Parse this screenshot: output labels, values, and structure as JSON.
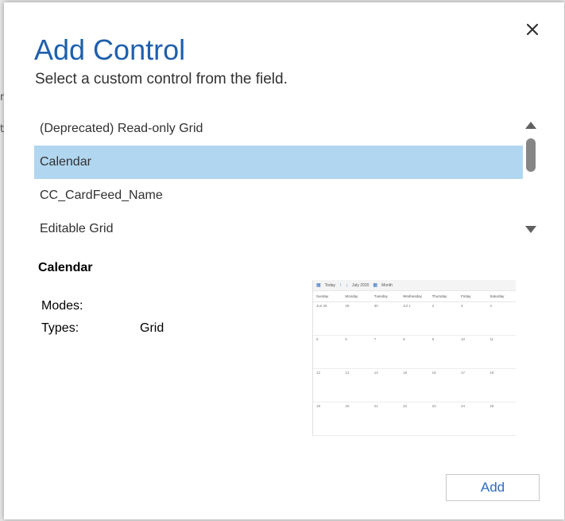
{
  "dialog": {
    "title": "Add Control",
    "subtitle": "Select a custom control from the field.",
    "close_icon": "close-icon"
  },
  "control_list": {
    "items": [
      {
        "label": "(Deprecated) Read-only Grid",
        "selected": false
      },
      {
        "label": "Calendar",
        "selected": true
      },
      {
        "label": "CC_CardFeed_Name",
        "selected": false
      },
      {
        "label": "Editable Grid",
        "selected": false
      }
    ],
    "selected_color": "#b1d6f0"
  },
  "details": {
    "title": "Calendar",
    "modes_label": "Modes:",
    "modes_value": "",
    "types_label": "Types:",
    "types_value": "Grid"
  },
  "preview": {
    "toolbar": {
      "today": "Today",
      "up": "↑",
      "down": "↓",
      "month_year": "July 2020",
      "view": "Month"
    },
    "weekdays": [
      "Sunday",
      "Monday",
      "Tuesday",
      "Wednesday",
      "Thursday",
      "Friday",
      "Saturday"
    ],
    "weeks": [
      [
        "Jun 28",
        "29",
        "30",
        "Jul 1",
        "2",
        "3",
        "4"
      ],
      [
        "5",
        "6",
        "7",
        "8",
        "9",
        "10",
        "11"
      ],
      [
        "12",
        "13",
        "14",
        "15",
        "16",
        "17",
        "18"
      ],
      [
        "19",
        "20",
        "21",
        "22",
        "23",
        "24",
        "25"
      ]
    ]
  },
  "actions": {
    "add_label": "Add"
  },
  "colors": {
    "title": "#1f5fad",
    "accent": "#2b6cc4"
  }
}
